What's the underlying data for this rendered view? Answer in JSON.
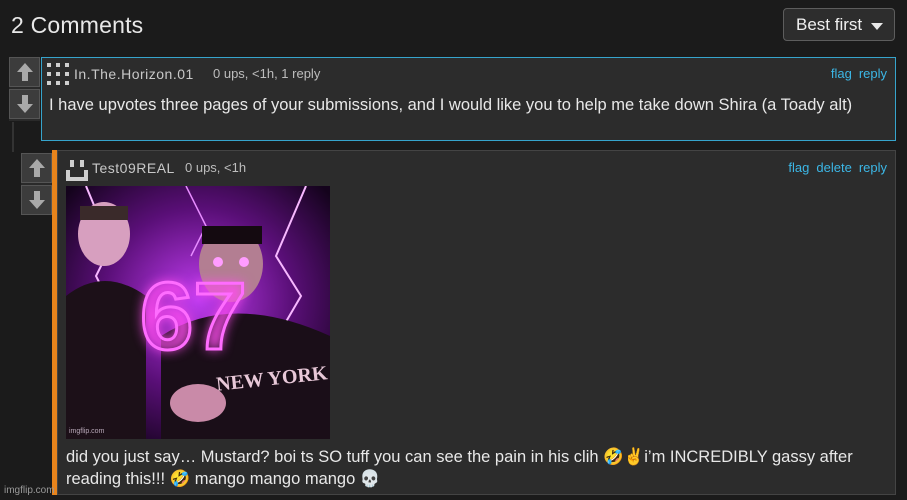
{
  "header": {
    "title": "2 Comments"
  },
  "sort": {
    "selected": "Best first"
  },
  "comments": [
    {
      "username": "In.The.Horizon.01",
      "meta": "0 ups, <1h, 1 reply",
      "actions": [
        "flag",
        "reply"
      ],
      "text": "I have upvotes three pages of your submissions, and I would like you to help me take down Shira (a Toady alt)"
    },
    {
      "username": "Test09REAL",
      "meta": "0 ups, <1h",
      "actions": [
        "flag",
        "delete",
        "reply"
      ],
      "image": {
        "overlay_text": "67",
        "shirt_text": "NEW YORK",
        "corner_mark": "imgflip.com"
      },
      "text": "did you just say… Mustard? boi ts SO tuff you can see the pain in his clih 🤣✌️i’m INCREDIBLY gassy after reading this!!! 🤣 mango mango mango 💀"
    }
  ],
  "watermark": "imgflip.com",
  "colors": {
    "accent": "#3cb7e6",
    "reply_bar": "#e8841c",
    "selected_border": "#36a4cc"
  },
  "icons": [
    "upvote-arrow-icon",
    "downvote-arrow-icon",
    "caret-down-icon",
    "user-avatar-icon"
  ]
}
